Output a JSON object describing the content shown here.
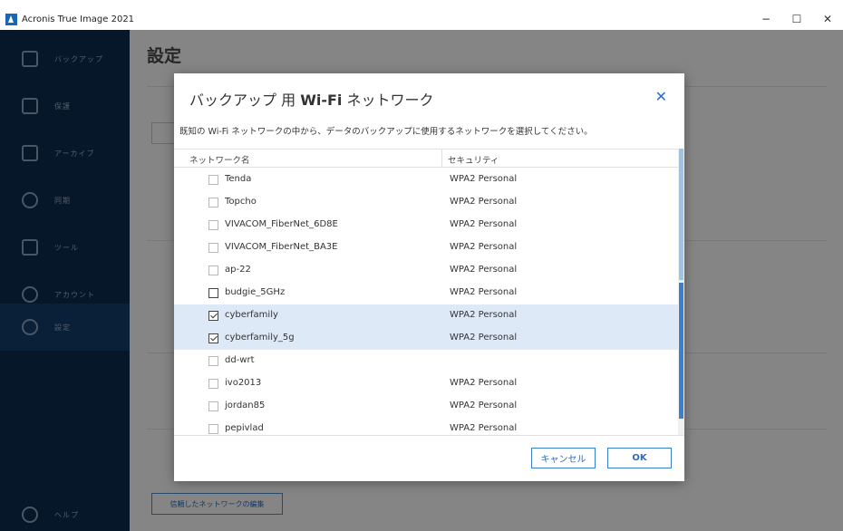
{
  "window": {
    "title": "Acronis True Image 2021",
    "minimize": "−",
    "maximize": "☐",
    "close": "✕"
  },
  "sidebar": {
    "items": [
      {
        "label": "バックアップ",
        "icon": "copy-icon"
      },
      {
        "label": "保護",
        "icon": "shield-icon"
      },
      {
        "label": "アーカイブ",
        "icon": "archive-icon"
      },
      {
        "label": "同期",
        "icon": "sync-icon"
      },
      {
        "label": "ツール",
        "icon": "grid-icon"
      },
      {
        "label": "アカウント",
        "icon": "user-icon"
      },
      {
        "label": "設定",
        "icon": "gear-icon",
        "active": true
      }
    ],
    "help_label": "ヘルプ"
  },
  "main": {
    "page_title": "設定",
    "edit_networks_button": "信頼したネットワークの編集"
  },
  "dialog": {
    "title_prefix": "バックアップ 用 ",
    "title_bold": "Wi-Fi",
    "title_suffix": " ネットワーク",
    "description": "既知の Wi-Fi ネットワークの中から、データのバックアップに使用するネットワークを選択してください。",
    "columns": {
      "name": "ネットワーク名",
      "security": "セキュリティ"
    },
    "rows": [
      {
        "name": "Tenda",
        "security": "WPA2 Personal",
        "checked": false
      },
      {
        "name": "Topcho",
        "security": "WPA2 Personal",
        "checked": false
      },
      {
        "name": "VIVACOM_FiberNet_6D8E",
        "security": "WPA2 Personal",
        "checked": false
      },
      {
        "name": "VIVACOM_FiberNet_BA3E",
        "security": "WPA2 Personal",
        "checked": false
      },
      {
        "name": "ap-22",
        "security": "WPA2 Personal",
        "checked": false
      },
      {
        "name": "budgie_5GHz",
        "security": "WPA2 Personal",
        "checked": false
      },
      {
        "name": "cyberfamily",
        "security": "WPA2 Personal",
        "checked": true
      },
      {
        "name": "cyberfamily_5g",
        "security": "WPA2 Personal",
        "checked": true
      },
      {
        "name": "dd-wrt",
        "security": "",
        "checked": false
      },
      {
        "name": "ivo2013",
        "security": "WPA2 Personal",
        "checked": false
      },
      {
        "name": "jordan85",
        "security": "WPA2 Personal",
        "checked": false
      },
      {
        "name": "pepivlad",
        "security": "WPA2 Personal",
        "checked": false
      }
    ],
    "cancel_label": "キャンセル",
    "ok_label": "OK",
    "close_label": "✕"
  }
}
